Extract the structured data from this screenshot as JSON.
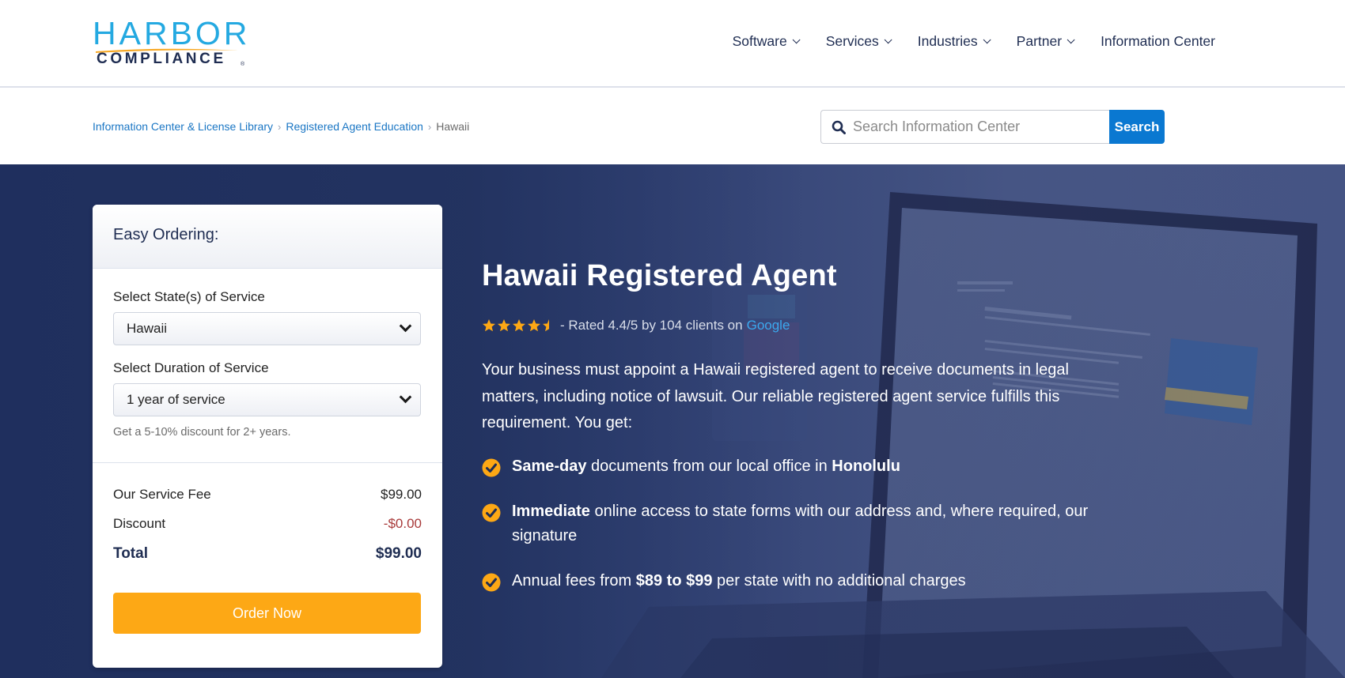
{
  "brand": {
    "name_top": "HARBOR",
    "name_bottom": "COMPLIANCE",
    "registered_mark": "®",
    "colors": {
      "primary_blue": "#24a9e1",
      "navy": "#1f2d52",
      "orange": "#fda815",
      "link_blue": "#1a76c4",
      "button_blue": "#0a78d1"
    }
  },
  "nav": {
    "items": [
      {
        "label": "Software",
        "has_dropdown": true
      },
      {
        "label": "Services",
        "has_dropdown": true
      },
      {
        "label": "Industries",
        "has_dropdown": true
      },
      {
        "label": "Partner",
        "has_dropdown": true
      },
      {
        "label": "Information Center",
        "has_dropdown": false
      }
    ]
  },
  "breadcrumb": {
    "items": [
      {
        "label": "Information Center & License Library",
        "link": true
      },
      {
        "label": "Registered Agent Education",
        "link": true
      },
      {
        "label": "Hawaii",
        "link": false
      }
    ],
    "separator": "›"
  },
  "search": {
    "icon": "search-icon",
    "placeholder": "Search Information Center",
    "value": "",
    "button_label": "Search"
  },
  "order_card": {
    "title": "Easy Ordering:",
    "state_label": "Select State(s) of Service",
    "state_value": "Hawaii",
    "duration_label": "Select Duration of Service",
    "duration_value": "1 year of service",
    "hint": "Get a 5-10% discount for 2+ years.",
    "fees": [
      {
        "label": "Our Service Fee",
        "value": "$99.00"
      },
      {
        "label": "Discount",
        "value": "-$0.00"
      },
      {
        "label": "Total",
        "value": "$99.00"
      }
    ],
    "order_button": "Order Now"
  },
  "hero": {
    "title": "Hawaii Registered Agent",
    "rating": {
      "stars": 4.4,
      "max": 5,
      "text": "- Rated 4.4/5 by 104 clients on",
      "source": "Google"
    },
    "paragraph": "Your business must appoint a Hawaii registered agent to receive documents in legal matters, including notice of lawsuit. Our reliable registered agent service fulfills this requirement. You get:",
    "benefits": [
      {
        "parts": [
          {
            "text": "Same-day",
            "bold": true
          },
          {
            "text": " documents from our local office in ",
            "bold": false
          },
          {
            "text": "Honolulu",
            "bold": true
          }
        ]
      },
      {
        "parts": [
          {
            "text": "Immediate",
            "bold": true
          },
          {
            "text": " online access to state forms with our address and, where required, our signature",
            "bold": false
          }
        ]
      },
      {
        "parts": [
          {
            "text": "Annual fees from ",
            "bold": false
          },
          {
            "text": "$89 to $99",
            "bold": true
          },
          {
            "text": " per state with no additional charges",
            "bold": false
          }
        ]
      }
    ]
  }
}
